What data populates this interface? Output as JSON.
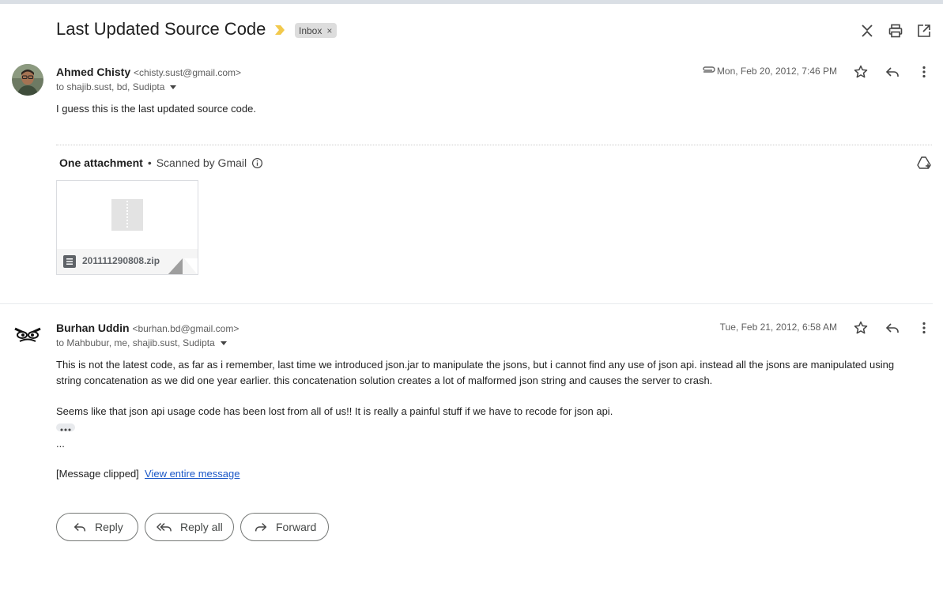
{
  "thread": {
    "subject": "Last Updated Source Code",
    "label": "Inbox",
    "label_remove": "×"
  },
  "header_icons": [
    "collapse-all-icon",
    "print-icon",
    "open-in-new-window-icon"
  ],
  "messages": [
    {
      "sender_name": "Ahmed Chisty",
      "sender_email": "<chisty.sust@gmail.com>",
      "recipients": "to shajib.sust, bd, Sudipta",
      "date": "Mon, Feb 20, 2012, 7:46 PM",
      "has_attachment_icon": true,
      "body": "I guess this is the last updated source code.",
      "attachments": {
        "header": "One attachment",
        "separator": "•",
        "scan_note": "Scanned by Gmail",
        "files": [
          {
            "name": "201111290808.zip",
            "type": "zip"
          }
        ]
      }
    },
    {
      "sender_name": "Burhan Uddin",
      "sender_email": "<burhan.bd@gmail.com>",
      "recipients": "to Mahbubur, me, shajib.sust, Sudipta",
      "date": "Tue, Feb 21, 2012, 6:58 AM",
      "body_p1": "This is not the latest code, as far as i remember, last time we introduced json.jar to manipulate the jsons, but i cannot find any use of json api. instead all the jsons are manipulated using string concatenation as we did one year earlier. this concatenation solution creates a lot of malformed json string and causes the server to crash.",
      "body_p2": "Seems like that json api usage code has been lost from all of us!! It is really a painful stuff if we have to recode for json api.",
      "body_more": "...",
      "clipped_text": "[Message clipped]",
      "clipped_link": "View entire message"
    }
  ],
  "actions": {
    "reply": "Reply",
    "reply_all": "Reply all",
    "forward": "Forward"
  },
  "colors": {
    "importance_marker": "#f2c94c",
    "link": "#1a57c7",
    "top_bar": "#dadfe5"
  }
}
